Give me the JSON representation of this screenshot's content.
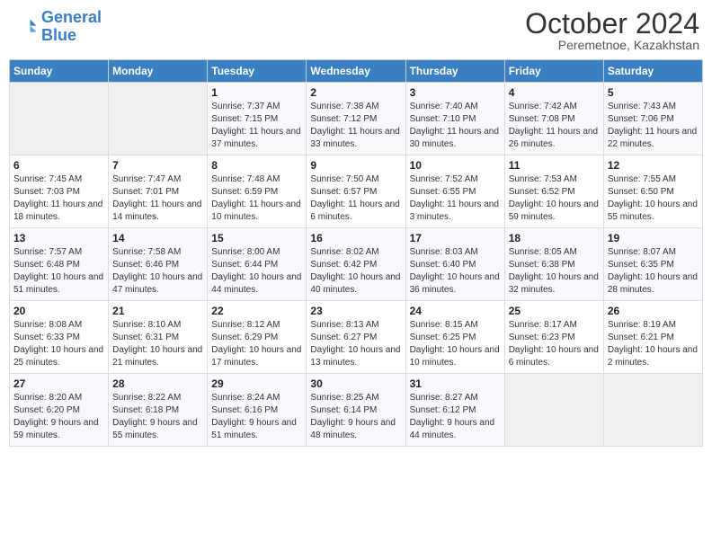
{
  "header": {
    "logo_line1": "General",
    "logo_line2": "Blue",
    "month": "October 2024",
    "location": "Peremetnoe, Kazakhstan"
  },
  "days_of_week": [
    "Sunday",
    "Monday",
    "Tuesday",
    "Wednesday",
    "Thursday",
    "Friday",
    "Saturday"
  ],
  "weeks": [
    [
      {
        "num": "",
        "sunrise": "",
        "sunset": "",
        "daylight": ""
      },
      {
        "num": "",
        "sunrise": "",
        "sunset": "",
        "daylight": ""
      },
      {
        "num": "1",
        "sunrise": "Sunrise: 7:37 AM",
        "sunset": "Sunset: 7:15 PM",
        "daylight": "Daylight: 11 hours and 37 minutes."
      },
      {
        "num": "2",
        "sunrise": "Sunrise: 7:38 AM",
        "sunset": "Sunset: 7:12 PM",
        "daylight": "Daylight: 11 hours and 33 minutes."
      },
      {
        "num": "3",
        "sunrise": "Sunrise: 7:40 AM",
        "sunset": "Sunset: 7:10 PM",
        "daylight": "Daylight: 11 hours and 30 minutes."
      },
      {
        "num": "4",
        "sunrise": "Sunrise: 7:42 AM",
        "sunset": "Sunset: 7:08 PM",
        "daylight": "Daylight: 11 hours and 26 minutes."
      },
      {
        "num": "5",
        "sunrise": "Sunrise: 7:43 AM",
        "sunset": "Sunset: 7:06 PM",
        "daylight": "Daylight: 11 hours and 22 minutes."
      }
    ],
    [
      {
        "num": "6",
        "sunrise": "Sunrise: 7:45 AM",
        "sunset": "Sunset: 7:03 PM",
        "daylight": "Daylight: 11 hours and 18 minutes."
      },
      {
        "num": "7",
        "sunrise": "Sunrise: 7:47 AM",
        "sunset": "Sunset: 7:01 PM",
        "daylight": "Daylight: 11 hours and 14 minutes."
      },
      {
        "num": "8",
        "sunrise": "Sunrise: 7:48 AM",
        "sunset": "Sunset: 6:59 PM",
        "daylight": "Daylight: 11 hours and 10 minutes."
      },
      {
        "num": "9",
        "sunrise": "Sunrise: 7:50 AM",
        "sunset": "Sunset: 6:57 PM",
        "daylight": "Daylight: 11 hours and 6 minutes."
      },
      {
        "num": "10",
        "sunrise": "Sunrise: 7:52 AM",
        "sunset": "Sunset: 6:55 PM",
        "daylight": "Daylight: 11 hours and 3 minutes."
      },
      {
        "num": "11",
        "sunrise": "Sunrise: 7:53 AM",
        "sunset": "Sunset: 6:52 PM",
        "daylight": "Daylight: 10 hours and 59 minutes."
      },
      {
        "num": "12",
        "sunrise": "Sunrise: 7:55 AM",
        "sunset": "Sunset: 6:50 PM",
        "daylight": "Daylight: 10 hours and 55 minutes."
      }
    ],
    [
      {
        "num": "13",
        "sunrise": "Sunrise: 7:57 AM",
        "sunset": "Sunset: 6:48 PM",
        "daylight": "Daylight: 10 hours and 51 minutes."
      },
      {
        "num": "14",
        "sunrise": "Sunrise: 7:58 AM",
        "sunset": "Sunset: 6:46 PM",
        "daylight": "Daylight: 10 hours and 47 minutes."
      },
      {
        "num": "15",
        "sunrise": "Sunrise: 8:00 AM",
        "sunset": "Sunset: 6:44 PM",
        "daylight": "Daylight: 10 hours and 44 minutes."
      },
      {
        "num": "16",
        "sunrise": "Sunrise: 8:02 AM",
        "sunset": "Sunset: 6:42 PM",
        "daylight": "Daylight: 10 hours and 40 minutes."
      },
      {
        "num": "17",
        "sunrise": "Sunrise: 8:03 AM",
        "sunset": "Sunset: 6:40 PM",
        "daylight": "Daylight: 10 hours and 36 minutes."
      },
      {
        "num": "18",
        "sunrise": "Sunrise: 8:05 AM",
        "sunset": "Sunset: 6:38 PM",
        "daylight": "Daylight: 10 hours and 32 minutes."
      },
      {
        "num": "19",
        "sunrise": "Sunrise: 8:07 AM",
        "sunset": "Sunset: 6:35 PM",
        "daylight": "Daylight: 10 hours and 28 minutes."
      }
    ],
    [
      {
        "num": "20",
        "sunrise": "Sunrise: 8:08 AM",
        "sunset": "Sunset: 6:33 PM",
        "daylight": "Daylight: 10 hours and 25 minutes."
      },
      {
        "num": "21",
        "sunrise": "Sunrise: 8:10 AM",
        "sunset": "Sunset: 6:31 PM",
        "daylight": "Daylight: 10 hours and 21 minutes."
      },
      {
        "num": "22",
        "sunrise": "Sunrise: 8:12 AM",
        "sunset": "Sunset: 6:29 PM",
        "daylight": "Daylight: 10 hours and 17 minutes."
      },
      {
        "num": "23",
        "sunrise": "Sunrise: 8:13 AM",
        "sunset": "Sunset: 6:27 PM",
        "daylight": "Daylight: 10 hours and 13 minutes."
      },
      {
        "num": "24",
        "sunrise": "Sunrise: 8:15 AM",
        "sunset": "Sunset: 6:25 PM",
        "daylight": "Daylight: 10 hours and 10 minutes."
      },
      {
        "num": "25",
        "sunrise": "Sunrise: 8:17 AM",
        "sunset": "Sunset: 6:23 PM",
        "daylight": "Daylight: 10 hours and 6 minutes."
      },
      {
        "num": "26",
        "sunrise": "Sunrise: 8:19 AM",
        "sunset": "Sunset: 6:21 PM",
        "daylight": "Daylight: 10 hours and 2 minutes."
      }
    ],
    [
      {
        "num": "27",
        "sunrise": "Sunrise: 8:20 AM",
        "sunset": "Sunset: 6:20 PM",
        "daylight": "Daylight: 9 hours and 59 minutes."
      },
      {
        "num": "28",
        "sunrise": "Sunrise: 8:22 AM",
        "sunset": "Sunset: 6:18 PM",
        "daylight": "Daylight: 9 hours and 55 minutes."
      },
      {
        "num": "29",
        "sunrise": "Sunrise: 8:24 AM",
        "sunset": "Sunset: 6:16 PM",
        "daylight": "Daylight: 9 hours and 51 minutes."
      },
      {
        "num": "30",
        "sunrise": "Sunrise: 8:25 AM",
        "sunset": "Sunset: 6:14 PM",
        "daylight": "Daylight: 9 hours and 48 minutes."
      },
      {
        "num": "31",
        "sunrise": "Sunrise: 8:27 AM",
        "sunset": "Sunset: 6:12 PM",
        "daylight": "Daylight: 9 hours and 44 minutes."
      },
      {
        "num": "",
        "sunrise": "",
        "sunset": "",
        "daylight": ""
      },
      {
        "num": "",
        "sunrise": "",
        "sunset": "",
        "daylight": ""
      }
    ]
  ]
}
